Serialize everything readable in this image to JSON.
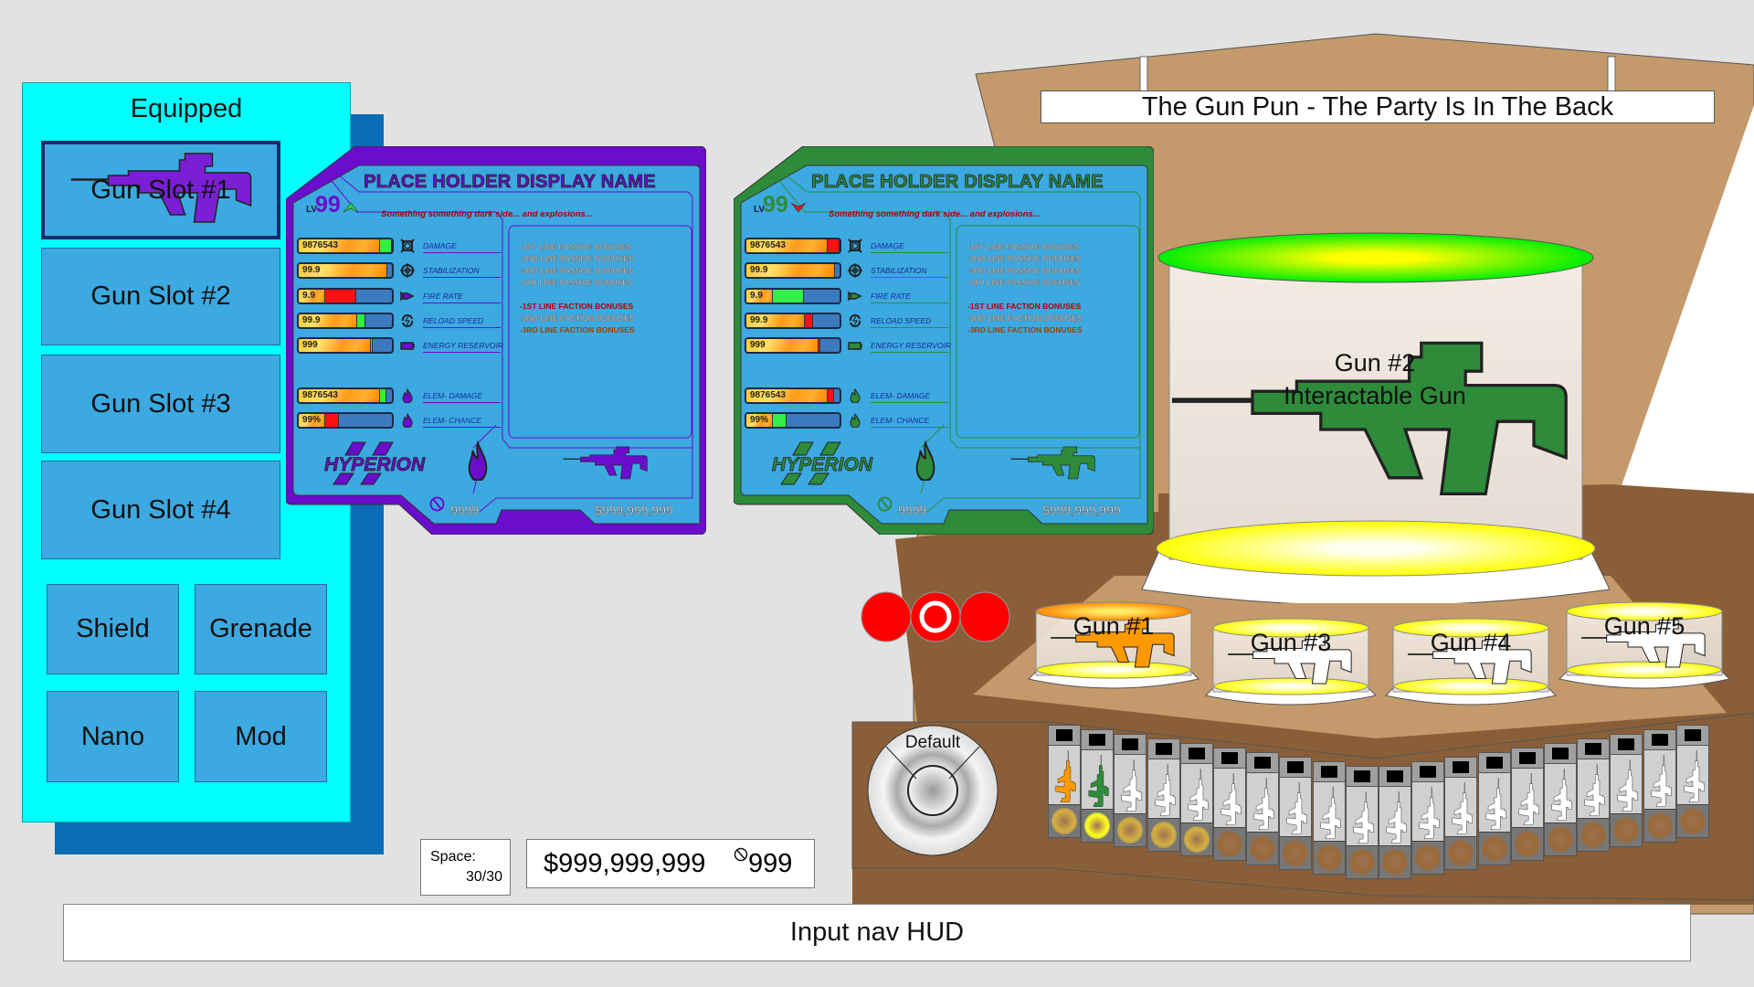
{
  "colors": {
    "panel": "#00ffff",
    "slot": "#3ca9e1",
    "card_blue": "#3ca9e1",
    "purple": "#6a0dcc",
    "green": "#2e8b3a",
    "tan": "#c49a6c",
    "brown": "#8a5e38",
    "red": "#ff0000",
    "yellow": "#ffff00"
  },
  "equipped": {
    "title": "Equipped",
    "slots": [
      {
        "label": "Gun Slot #1",
        "selected": true,
        "gun_color": "#7a1fd6"
      },
      {
        "label": "Gun Slot #2"
      },
      {
        "label": "Gun Slot #3"
      },
      {
        "label": "Gun Slot #4"
      }
    ],
    "gear": [
      {
        "label": "Shield"
      },
      {
        "label": "Grenade"
      },
      {
        "label": "Nano"
      },
      {
        "label": "Mod"
      }
    ]
  },
  "cards": [
    {
      "accent": "#6a0dcc",
      "title": "PLACE HOLDER DISPLAY NAME",
      "lv_prefix": "LV",
      "level": "99",
      "level_trend": "up",
      "level_trend_color": "#22cc44",
      "tagline": "Something something dark side... and explosions...",
      "stats": [
        {
          "value": "9876543",
          "label": "DAMAGE",
          "icon": "crosshair-box-icon",
          "base": 0.87,
          "delta": 1.0,
          "delta_color": "#33ee44"
        },
        {
          "value": "99.9",
          "label": "STABILIZATION",
          "icon": "target-icon",
          "base": 0.95,
          "delta": 0.95,
          "delta_color": "#33ee44"
        },
        {
          "value": "9.9",
          "label": "FIRE RATE",
          "icon": "bullet-icon",
          "base": 0.28,
          "delta": 0.62,
          "delta_color": "#ff1111"
        },
        {
          "value": "99.9",
          "label": "RELOAD SPEED",
          "icon": "reload-icon",
          "base": 0.63,
          "delta": 0.72,
          "delta_color": "#33ee44"
        },
        {
          "value": "999",
          "label": "ENERGY RESERVOIR",
          "icon": "battery-icon",
          "base": 0.77,
          "delta": 0.79,
          "delta_color": "#33ee44"
        },
        {
          "value": "9876543",
          "label": "ELEM- DAMAGE",
          "icon": "flame-icon",
          "base": 0.87,
          "delta": 0.94,
          "delta_color": "#33ee44"
        },
        {
          "value": "99%",
          "label": "ELEM- CHANCE",
          "icon": "flame-icon",
          "base": 0.28,
          "delta": 0.43,
          "delta_color": "#ff1111"
        }
      ],
      "bonuses": [
        {
          "text": "-1ST LINE PASSIVE BONUSES",
          "kind": "p"
        },
        {
          "text": "-2ND LINE PASSIVE BONUSES",
          "kind": "p"
        },
        {
          "text": "-3RD LINE PASSIVE BONUSES",
          "kind": "p"
        },
        {
          "text": "-4TH LINE PASSIVE BONUSES",
          "kind": "p"
        },
        {
          "text": "-1ST LINE FACTION BONUSES",
          "kind": "f1"
        },
        {
          "text": "-2ND LINE FACTION BONUSES",
          "kind": "p"
        },
        {
          "text": "-3RD LINE FACTION BONUSES",
          "kind": "f3"
        }
      ],
      "manufacturer": "HYPERION",
      "count": "9999",
      "price": "$999,999,999"
    },
    {
      "accent": "#2e8b3a",
      "title": "PLACE HOLDER DISPLAY NAME",
      "lv_prefix": "LV",
      "level": "99",
      "level_trend": "down",
      "level_trend_color": "#ee1111",
      "tagline": "Something something dark side... and explosions...",
      "stats": [
        {
          "value": "9876543",
          "label": "DAMAGE",
          "icon": "crosshair-box-icon",
          "base": 0.87,
          "delta": 1.0,
          "delta_color": "#ff1111"
        },
        {
          "value": "99.9",
          "label": "STABILIZATION",
          "icon": "target-icon",
          "base": 0.95,
          "delta": 0.95,
          "delta_color": "#ff1111"
        },
        {
          "value": "9.9",
          "label": "FIRE RATE",
          "icon": "bullet-icon",
          "base": 0.28,
          "delta": 0.62,
          "delta_color": "#33ee44"
        },
        {
          "value": "99.9",
          "label": "RELOAD SPEED",
          "icon": "reload-icon",
          "base": 0.63,
          "delta": 0.72,
          "delta_color": "#ff1111"
        },
        {
          "value": "999",
          "label": "ENERGY RESERVOIR",
          "icon": "battery-icon",
          "base": 0.77,
          "delta": 0.79,
          "delta_color": "#ff1111"
        },
        {
          "value": "9876543",
          "label": "ELEM- DAMAGE",
          "icon": "flame-icon",
          "base": 0.87,
          "delta": 0.94,
          "delta_color": "#ff1111"
        },
        {
          "value": "99%",
          "label": "ELEM- CHANCE",
          "icon": "flame-icon",
          "base": 0.28,
          "delta": 0.43,
          "delta_color": "#33ee44"
        }
      ],
      "bonuses": [
        {
          "text": "-1ST LINE PASSIVE BONUSES",
          "kind": "p"
        },
        {
          "text": "-2ND LINE PASSIVE BONUSES",
          "kind": "p"
        },
        {
          "text": "-3RD LINE PASSIVE BONUSES",
          "kind": "p"
        },
        {
          "text": "-4TH LINE PASSIVE BONUSES",
          "kind": "p"
        },
        {
          "text": "-1ST LINE FACTION BONUSES",
          "kind": "f1"
        },
        {
          "text": "-2ND LINE FACTION BONUSES",
          "kind": "p"
        },
        {
          "text": "-3RD LINE FACTION BONUSES",
          "kind": "f3"
        }
      ],
      "manufacturer": "HYPERION",
      "count": "9999",
      "price": "$999,999,999"
    }
  ],
  "store": {
    "sign": "The Gun Pun - The Party Is In The Back",
    "featured": {
      "label": "Gun #2",
      "sublabel": "Interactable Gun",
      "gun_color": "#2e8b3a"
    },
    "pedestals": [
      {
        "label": "Gun #1",
        "gun_color": "#ff9900",
        "top_color": "#ff9900"
      },
      {
        "label": "Gun #3",
        "gun_color": "#ffffff",
        "top_color": "#ffff00"
      },
      {
        "label": "Gun #4",
        "gun_color": "#ffffff",
        "top_color": "#ffff00"
      },
      {
        "label": "Gun #5",
        "gun_color": "#ffffff",
        "top_color": "#ffff00"
      }
    ],
    "page_dots": [
      {
        "active": false
      },
      {
        "active": true
      },
      {
        "active": false
      }
    ],
    "filter_wheel": {
      "label": "Default"
    },
    "shelf": [
      {
        "gun": "#ff9900",
        "light": "#d4b040"
      },
      {
        "gun": "#2e8b3a",
        "light": "#ffff20"
      },
      {
        "gun": "#ffffff",
        "light": "#d4b040"
      },
      {
        "gun": "#ffffff",
        "light": "#d4b040"
      },
      {
        "gun": "#ffffff",
        "light": "#d4b040"
      },
      {
        "gun": "#ffffff",
        "light": "#9a6a3a"
      },
      {
        "gun": "#ffffff",
        "light": "#9a6a3a"
      },
      {
        "gun": "#ffffff",
        "light": "#9a6a3a"
      },
      {
        "gun": "#ffffff",
        "light": "#9a6a3a"
      },
      {
        "gun": "#ffffff",
        "light": "#9a6a3a"
      },
      {
        "gun": "#ffffff",
        "light": "#9a6a3a"
      },
      {
        "gun": "#ffffff",
        "light": "#9a6a3a"
      },
      {
        "gun": "#ffffff",
        "light": "#9a6a3a"
      },
      {
        "gun": "#ffffff",
        "light": "#9a6a3a"
      },
      {
        "gun": "#ffffff",
        "light": "#9a6a3a"
      },
      {
        "gun": "#ffffff",
        "light": "#9a6a3a"
      },
      {
        "gun": "#ffffff",
        "light": "#9a6a3a"
      },
      {
        "gun": "#ffffff",
        "light": "#9a6a3a"
      },
      {
        "gun": "#ffffff",
        "light": "#9a6a3a"
      },
      {
        "gun": "#ffffff",
        "light": "#9a6a3a"
      }
    ]
  },
  "inventory": {
    "space_label": "Space:",
    "space_value": "30/30",
    "money": "$999,999,999",
    "eridium": "999"
  },
  "hud": {
    "label": "Input nav HUD"
  }
}
